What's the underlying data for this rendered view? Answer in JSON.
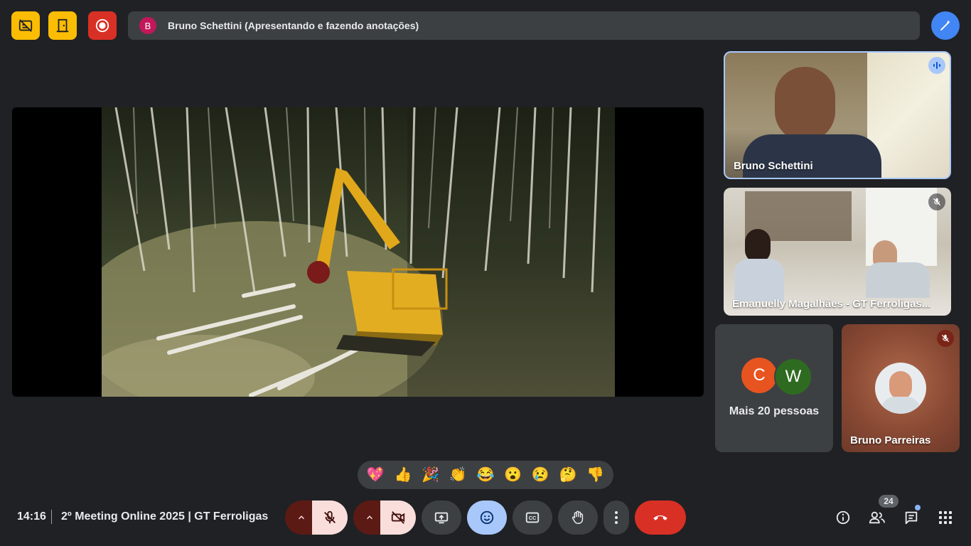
{
  "top_bar": {
    "presenter_initial": "B",
    "presenter_text": "Bruno Schettini (Apresentando e fazendo anotações)"
  },
  "icons": {
    "captions_off": "no-captions-icon",
    "door": "door-icon",
    "record": "record-icon",
    "annotate": "annotate-pen-icon",
    "speaking": "speaking-icon",
    "mic_off": "mic-off-icon",
    "cam_off": "camera-off-icon"
  },
  "participants": {
    "tile1_name": "Bruno Schettini",
    "tile2_name": "Emanuelly Magalhães - GT Ferroligas...",
    "more_avatar_1": "C",
    "more_avatar_2": "W",
    "more_label": "Mais 20 pessoas",
    "tile4_name": "Bruno Parreiras"
  },
  "reactions": [
    "💖",
    "👍",
    "🎉",
    "👏",
    "😂",
    "😮",
    "😢",
    "🤔",
    "👎"
  ],
  "bottom_bar": {
    "time": "14:16",
    "meeting_title": "2º Meeting Online 2025 | GT Ferroligas",
    "people_count": "24"
  },
  "colors": {
    "background": "#202124",
    "yellow": "#fbbc04",
    "red": "#d93025",
    "blue": "#4285f4",
    "accent_light": "#a8c7fa"
  }
}
